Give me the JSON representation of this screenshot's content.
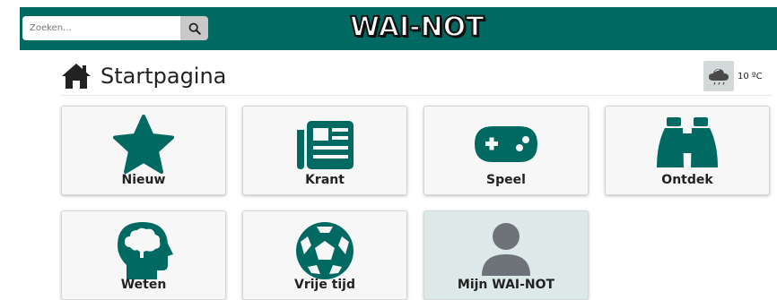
{
  "header": {
    "search_placeholder": "Zoeken...",
    "logo": "WAI-NOT"
  },
  "page": {
    "title": "Startpagina"
  },
  "weather": {
    "temperature": "10 ºC",
    "icon": "cloud-rain-icon"
  },
  "colors": {
    "brand": "#006a62",
    "active_tile": "#dce9e8",
    "avatar": "#6d7378"
  },
  "tiles": [
    {
      "label": "Nieuw",
      "icon": "star-icon"
    },
    {
      "label": "Krant",
      "icon": "newspaper-icon"
    },
    {
      "label": "Speel",
      "icon": "gamepad-icon"
    },
    {
      "label": "Ontdek",
      "icon": "binoculars-icon"
    },
    {
      "label": "Weten",
      "icon": "brain-head-icon"
    },
    {
      "label": "Vrije tijd",
      "icon": "soccer-ball-icon"
    },
    {
      "label": "Mijn WAI-NOT",
      "icon": "user-icon"
    }
  ]
}
